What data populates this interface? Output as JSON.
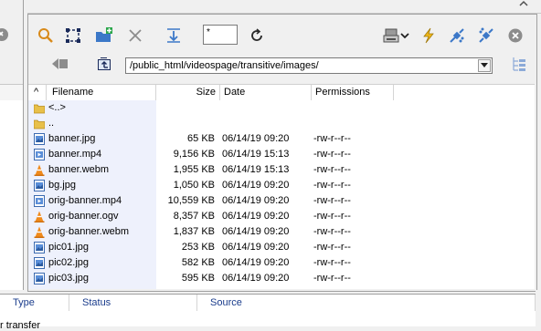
{
  "toolbar": {
    "filter_value": "*",
    "path_value": "/public_html/videospage/transitive/images/"
  },
  "columns": {
    "sort_indicator": "^",
    "filename": "Filename",
    "size": "Size",
    "date": "Date",
    "permissions": "Permissions"
  },
  "files": [
    {
      "name": "<..>",
      "size": "",
      "date": "",
      "perms": "",
      "icon": "folder-icon"
    },
    {
      "name": "..",
      "size": "",
      "date": "",
      "perms": "",
      "icon": "folder-icon"
    },
    {
      "name": "banner.jpg",
      "size": "65 KB",
      "date": "06/14/19  09:20",
      "perms": "-rw-r--r--",
      "icon": "image-file-icon"
    },
    {
      "name": "banner.mp4",
      "size": "9,156 KB",
      "date": "06/14/19  15:13",
      "perms": "-rw-r--r--",
      "icon": "video-file-icon"
    },
    {
      "name": "banner.webm",
      "size": "1,955 KB",
      "date": "06/14/19  15:13",
      "perms": "-rw-r--r--",
      "icon": "vlc-cone-icon"
    },
    {
      "name": "bg.jpg",
      "size": "1,050 KB",
      "date": "06/14/19  09:20",
      "perms": "-rw-r--r--",
      "icon": "image-file-icon"
    },
    {
      "name": "orig-banner.mp4",
      "size": "10,559 KB",
      "date": "06/14/19  09:20",
      "perms": "-rw-r--r--",
      "icon": "video-file-icon"
    },
    {
      "name": "orig-banner.ogv",
      "size": "8,357 KB",
      "date": "06/14/19  09:20",
      "perms": "-rw-r--r--",
      "icon": "vlc-cone-icon"
    },
    {
      "name": "orig-banner.webm",
      "size": "1,837 KB",
      "date": "06/14/19  09:20",
      "perms": "-rw-r--r--",
      "icon": "vlc-cone-icon"
    },
    {
      "name": "pic01.jpg",
      "size": "253 KB",
      "date": "06/14/19  09:20",
      "perms": "-rw-r--r--",
      "icon": "image-file-icon"
    },
    {
      "name": "pic02.jpg",
      "size": "582 KB",
      "date": "06/14/19  09:20",
      "perms": "-rw-r--r--",
      "icon": "image-file-icon"
    },
    {
      "name": "pic03.jpg",
      "size": "595 KB",
      "date": "06/14/19  09:20",
      "perms": "-rw-r--r--",
      "icon": "image-file-icon"
    }
  ],
  "queue": {
    "type": "Type",
    "status": "Status",
    "source": "Source",
    "partial_text": "r transfer"
  },
  "colors": {
    "name_column_shade": "#eef1fc",
    "queue_header_text": "#1a3c8c",
    "accent_blue": "#3c78c8",
    "vlc_orange": "#f08a1c"
  }
}
